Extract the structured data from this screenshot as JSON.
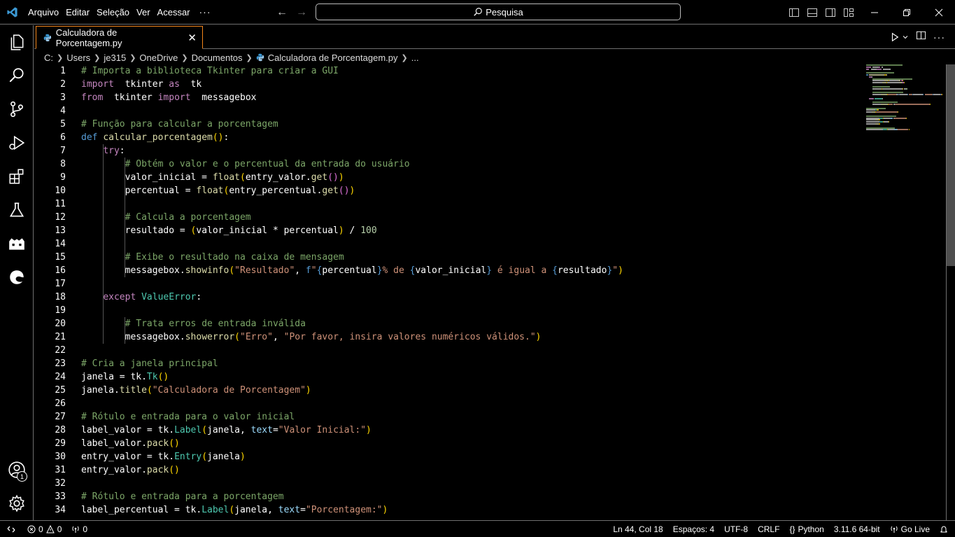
{
  "titlebar": {
    "menu": [
      "Arquivo",
      "Editar",
      "Seleção",
      "Ver",
      "Acessar"
    ],
    "more": "···",
    "search_placeholder": "Pesquisa"
  },
  "tab": {
    "filename": "Calculadora de Porcentagem.py",
    "close": "✕"
  },
  "breadcrumb": [
    "C:",
    "Users",
    "je315",
    "OneDrive",
    "Documentos"
  ],
  "breadcrumb_file": "Calculadora de Porcentagem.py",
  "breadcrumb_more": "...",
  "editor": {
    "line_numbers": [
      "1",
      "2",
      "3",
      "4",
      "5",
      "6",
      "7",
      "8",
      "9",
      "10",
      "11",
      "12",
      "13",
      "14",
      "15",
      "16",
      "17",
      "18",
      "19",
      "20",
      "21",
      "22",
      "23",
      "24",
      "25",
      "26",
      "27",
      "28",
      "29",
      "30",
      "31",
      "32",
      "33",
      "34"
    ],
    "lines": [
      [
        [
          "c-com",
          "# Importa a biblioteca Tkinter para criar a GUI"
        ]
      ],
      [
        [
          "c-kw",
          "import"
        ],
        [
          "",
          "  tkinter "
        ],
        [
          "c-kw",
          "as"
        ],
        [
          "",
          "  tk"
        ]
      ],
      [
        [
          "c-kw",
          "from"
        ],
        [
          "",
          "  tkinter "
        ],
        [
          "c-kw",
          "import"
        ],
        [
          "",
          "  messagebox"
        ]
      ],
      [],
      [
        [
          "c-com",
          "# Função para calcular a porcentagem"
        ]
      ],
      [
        [
          "c-kw2",
          "def"
        ],
        [
          "",
          " "
        ],
        [
          "c-fn",
          "calcular_porcentagem"
        ],
        [
          "c-b1",
          "()"
        ],
        [
          "",
          ":"
        ]
      ],
      [
        [
          "",
          "    "
        ],
        [
          "c-kw",
          "try"
        ],
        [
          "",
          ":"
        ]
      ],
      [
        [
          "",
          "        "
        ],
        [
          "c-com",
          "# Obtém o valor e o percentual da entrada do usuário"
        ]
      ],
      [
        [
          "",
          "        valor_inicial = "
        ],
        [
          "c-fn",
          "float"
        ],
        [
          "c-b1",
          "("
        ],
        [
          "",
          "entry_valor."
        ],
        [
          "c-fn",
          "get"
        ],
        [
          "c-b2",
          "()"
        ],
        [
          "c-b1",
          ")"
        ]
      ],
      [
        [
          "",
          "        percentual = "
        ],
        [
          "c-fn",
          "float"
        ],
        [
          "c-b1",
          "("
        ],
        [
          "",
          "entry_percentual."
        ],
        [
          "c-fn",
          "get"
        ],
        [
          "c-b2",
          "()"
        ],
        [
          "c-b1",
          ")"
        ]
      ],
      [],
      [
        [
          "",
          "        "
        ],
        [
          "c-com",
          "# Calcula a porcentagem"
        ]
      ],
      [
        [
          "",
          "        resultado = "
        ],
        [
          "c-b1",
          "("
        ],
        [
          "",
          "valor_inicial * percentual"
        ],
        [
          "c-b1",
          ")"
        ],
        [
          "",
          " / "
        ],
        [
          "c-num",
          "100"
        ]
      ],
      [],
      [
        [
          "",
          "        "
        ],
        [
          "c-com",
          "# Exibe o resultado na caixa de mensagem"
        ]
      ],
      [
        [
          "",
          "        messagebox."
        ],
        [
          "c-fn",
          "showinfo"
        ],
        [
          "c-b1",
          "("
        ],
        [
          "c-str",
          "\"Resultado\""
        ],
        [
          "",
          ", "
        ],
        [
          "c-kw2",
          "f"
        ],
        [
          "c-str",
          "\""
        ],
        [
          "c-kw2",
          "{"
        ],
        [
          "",
          "percentual"
        ],
        [
          "c-kw2",
          "}"
        ],
        [
          "c-str",
          "% de "
        ],
        [
          "c-kw2",
          "{"
        ],
        [
          "",
          "valor_inicial"
        ],
        [
          "c-kw2",
          "}"
        ],
        [
          "c-str",
          " é igual a "
        ],
        [
          "c-kw2",
          "{"
        ],
        [
          "",
          "resultado"
        ],
        [
          "c-kw2",
          "}"
        ],
        [
          "c-str",
          "\""
        ],
        [
          "c-b1",
          ")"
        ]
      ],
      [],
      [
        [
          "",
          "    "
        ],
        [
          "c-kw",
          "except"
        ],
        [
          "",
          " "
        ],
        [
          "c-cls",
          "ValueError"
        ],
        [
          "",
          ":"
        ]
      ],
      [],
      [
        [
          "",
          "        "
        ],
        [
          "c-com",
          "# Trata erros de entrada inválida"
        ]
      ],
      [
        [
          "",
          "        messagebox."
        ],
        [
          "c-fn",
          "showerror"
        ],
        [
          "c-b1",
          "("
        ],
        [
          "c-str",
          "\"Erro\""
        ],
        [
          "",
          ", "
        ],
        [
          "c-str",
          "\"Por favor, insira valores numéricos válidos.\""
        ],
        [
          "c-b1",
          ")"
        ]
      ],
      [],
      [
        [
          "c-com",
          "# Cria a janela principal"
        ]
      ],
      [
        [
          "",
          "janela = tk."
        ],
        [
          "c-cls",
          "Tk"
        ],
        [
          "c-b1",
          "()"
        ]
      ],
      [
        [
          "",
          "janela."
        ],
        [
          "c-fn",
          "title"
        ],
        [
          "c-b1",
          "("
        ],
        [
          "c-str",
          "\"Calculadora de Porcentagem\""
        ],
        [
          "c-b1",
          ")"
        ]
      ],
      [],
      [
        [
          "c-com",
          "# Rótulo e entrada para o valor inicial"
        ]
      ],
      [
        [
          "",
          "label_valor = tk."
        ],
        [
          "c-cls",
          "Label"
        ],
        [
          "c-b1",
          "("
        ],
        [
          "",
          "janela, "
        ],
        [
          "c-var",
          "text"
        ],
        [
          "",
          "="
        ],
        [
          "c-str",
          "\"Valor Inicial:\""
        ],
        [
          "c-b1",
          ")"
        ]
      ],
      [
        [
          "",
          "label_valor."
        ],
        [
          "c-fn",
          "pack"
        ],
        [
          "c-b1",
          "()"
        ]
      ],
      [
        [
          "",
          "entry_valor = tk."
        ],
        [
          "c-cls",
          "Entry"
        ],
        [
          "c-b1",
          "("
        ],
        [
          "",
          "janela"
        ],
        [
          "c-b1",
          ")"
        ]
      ],
      [
        [
          "",
          "entry_valor."
        ],
        [
          "c-fn",
          "pack"
        ],
        [
          "c-b1",
          "()"
        ]
      ],
      [],
      [
        [
          "c-com",
          "# Rótulo e entrada para a porcentagem"
        ]
      ],
      [
        [
          "",
          "label_percentual = tk."
        ],
        [
          "c-cls",
          "Label"
        ],
        [
          "c-b1",
          "("
        ],
        [
          "",
          "janela, "
        ],
        [
          "c-var",
          "text"
        ],
        [
          "",
          "="
        ],
        [
          "c-str",
          "\"Porcentagem:\""
        ],
        [
          "c-b1",
          ")"
        ]
      ]
    ]
  },
  "status": {
    "remote_icon": "remote-icon",
    "errors": "0",
    "warnings": "0",
    "ports": "0",
    "position": "Ln 44, Col 18",
    "spaces": "Espaços: 4",
    "encoding": "UTF-8",
    "eol": "CRLF",
    "language": "Python",
    "interpreter": "3.11.6 64-bit",
    "golive": "Go Live"
  },
  "accounts_badge": "1",
  "colors": {
    "background": "#000000",
    "border": "#6f6f6f",
    "tab_active_border": "#f38518",
    "vscode_blue": "#3c99d4"
  }
}
